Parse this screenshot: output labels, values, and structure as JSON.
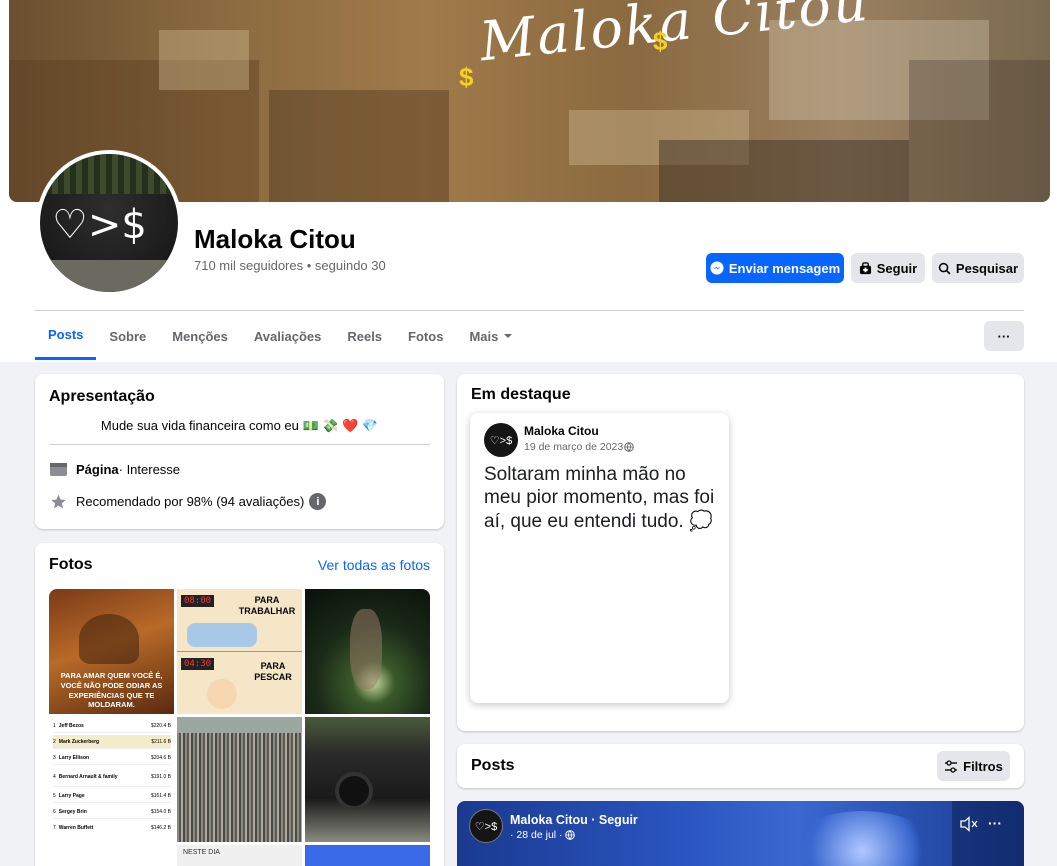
{
  "cover": {
    "title": "Maloka Citou",
    "dollar_glyph": "$"
  },
  "profile": {
    "avatar_glyph": "♡>$",
    "name": "Maloka Citou",
    "stats": "710 mil seguidores • seguindo 30",
    "actions": {
      "message": "Enviar mensagem",
      "follow": "Seguir",
      "search": "Pesquisar"
    }
  },
  "tabs": [
    {
      "label": "Posts",
      "active": true
    },
    {
      "label": "Sobre"
    },
    {
      "label": "Menções"
    },
    {
      "label": "Avaliações"
    },
    {
      "label": "Reels"
    },
    {
      "label": "Fotos"
    },
    {
      "label": "Mais"
    }
  ],
  "more_button": "···",
  "intro": {
    "title": "Apresentação",
    "bio": "Mude sua vida financeira como eu 💵 💸 ❤️ 💎",
    "category_bold": "Página",
    "category_rest": " · Interesse",
    "rating": "Recomendado por 98% (94 avaliações)"
  },
  "photos": {
    "title": "Fotos",
    "see_all": "Ver todas as fotos",
    "p1_caption": "PARA AMAR QUEM VOCÊ É, VOCÊ NÃO PODE ODIAR AS EXPERIÊNCIAS QUE TE MOLDARAM.",
    "p2": {
      "clock1": "08:00",
      "text1": "PARA TRABALHAR",
      "clock2": "04:30",
      "text2": "PARA PESCAR"
    },
    "ranking": [
      {
        "n": "1",
        "name": "Jeff Bezos",
        "value": "$220.4 B"
      },
      {
        "n": "2",
        "name": "Mark Zuckerberg",
        "value": "$211.6 B"
      },
      {
        "n": "3",
        "name": "Larry Ellison",
        "value": "$204.6 B"
      },
      {
        "n": "4",
        "name": "Bernard Arnault & family",
        "value": "$191.0 B"
      },
      {
        "n": "5",
        "name": "Larry Page",
        "value": "$161.4 B"
      },
      {
        "n": "6",
        "name": "Sergey Brin",
        "value": "$154.0 B"
      },
      {
        "n": "7",
        "name": "Warren Buffett",
        "value": "$146.2 B"
      }
    ],
    "p8_caption": "NESTE DIA"
  },
  "featured": {
    "title": "Em destaque",
    "author": "Maloka Citou",
    "date": "19 de março de 2023",
    "text": "Soltaram minha mão no meu pior momento, mas foi aí, que eu entendi tudo. 💭"
  },
  "posts": {
    "title": "Posts",
    "filters": "Filtros",
    "first_post": {
      "author": "Maloka Citou · Seguir",
      "date": "· 28 de jul ·"
    }
  }
}
